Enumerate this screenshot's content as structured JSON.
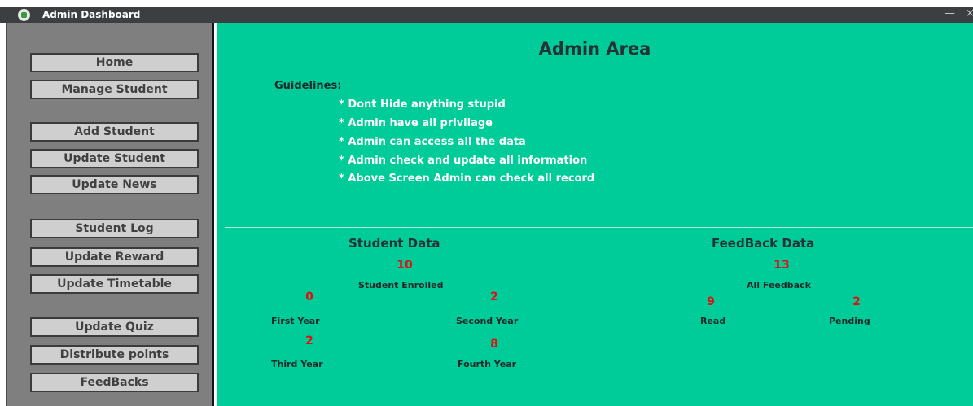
{
  "window": {
    "title": "Admin Dashboard",
    "minimize": "—",
    "close": "×"
  },
  "sidebar": {
    "items": [
      {
        "label": "Home"
      },
      {
        "label": "Manage Student"
      },
      {
        "label": "Add Student"
      },
      {
        "label": "Update Student"
      },
      {
        "label": "Update News"
      },
      {
        "label": "Student Log"
      },
      {
        "label": "Update Reward"
      },
      {
        "label": "Update Timetable"
      },
      {
        "label": "Update Quiz"
      },
      {
        "label": "Distribute points"
      },
      {
        "label": "FeedBacks"
      }
    ]
  },
  "main": {
    "title": "Admin Area",
    "guidelines_heading": "Guidelines:",
    "guidelines": [
      "* Dont Hide anything stupid",
      "* Admin have all privilage",
      "* Admin can access all the data",
      "* Admin check and update all information",
      "* Above Screen Admin can check all record"
    ]
  },
  "student_data": {
    "title": "Student Data",
    "enrolled": {
      "value": "10",
      "label": "Student Enrolled"
    },
    "first_year": {
      "value": "0",
      "label": "First Year"
    },
    "second_year": {
      "value": "2",
      "label": "Second Year"
    },
    "third_year": {
      "value": "2",
      "label": "Third Year"
    },
    "fourth_year": {
      "value": "8",
      "label": "Fourth Year"
    }
  },
  "feedback_data": {
    "title": "FeedBack Data",
    "all": {
      "value": "13",
      "label": "All Feedback"
    },
    "read": {
      "value": "9",
      "label": "Read"
    },
    "pending": {
      "value": "2",
      "label": "Pending"
    }
  },
  "colors": {
    "main_bg": "#00cc99",
    "sidebar_bg": "#7f7f7f",
    "number": "#e01010"
  }
}
